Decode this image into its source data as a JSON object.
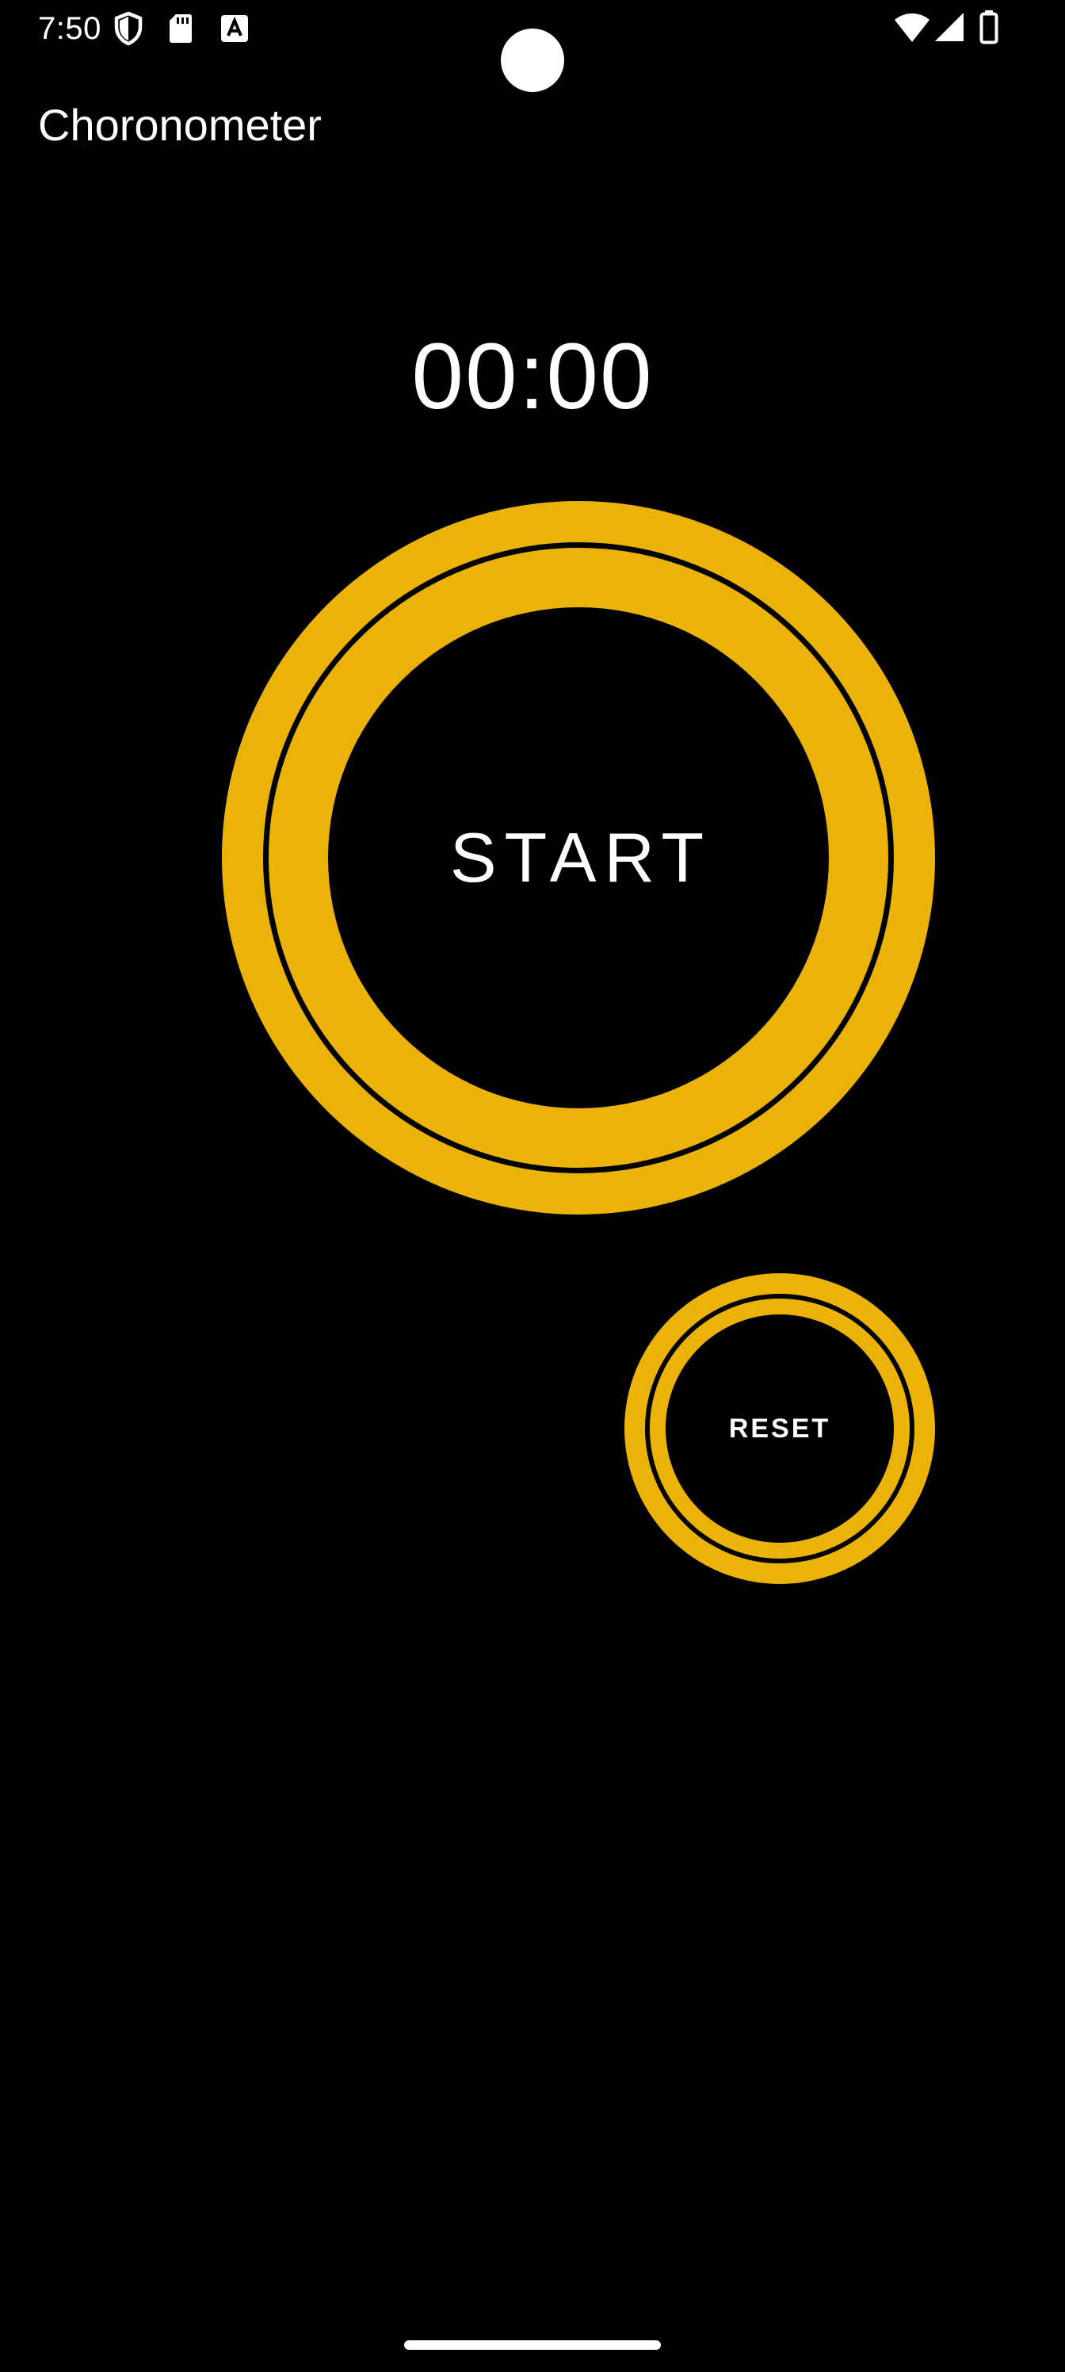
{
  "status_bar": {
    "time": "7:50",
    "icons": [
      "shield-icon",
      "sd-card-icon",
      "text-a-icon",
      "wifi-icon",
      "signal-icon",
      "battery-icon"
    ]
  },
  "app_bar": {
    "title": "Choronometer"
  },
  "chronometer": {
    "display": "00:00"
  },
  "buttons": {
    "start_label": "START",
    "reset_label": "RESET"
  },
  "colors": {
    "background": "#000000",
    "accent": "#EBB308",
    "text": "#FFFFFF"
  }
}
